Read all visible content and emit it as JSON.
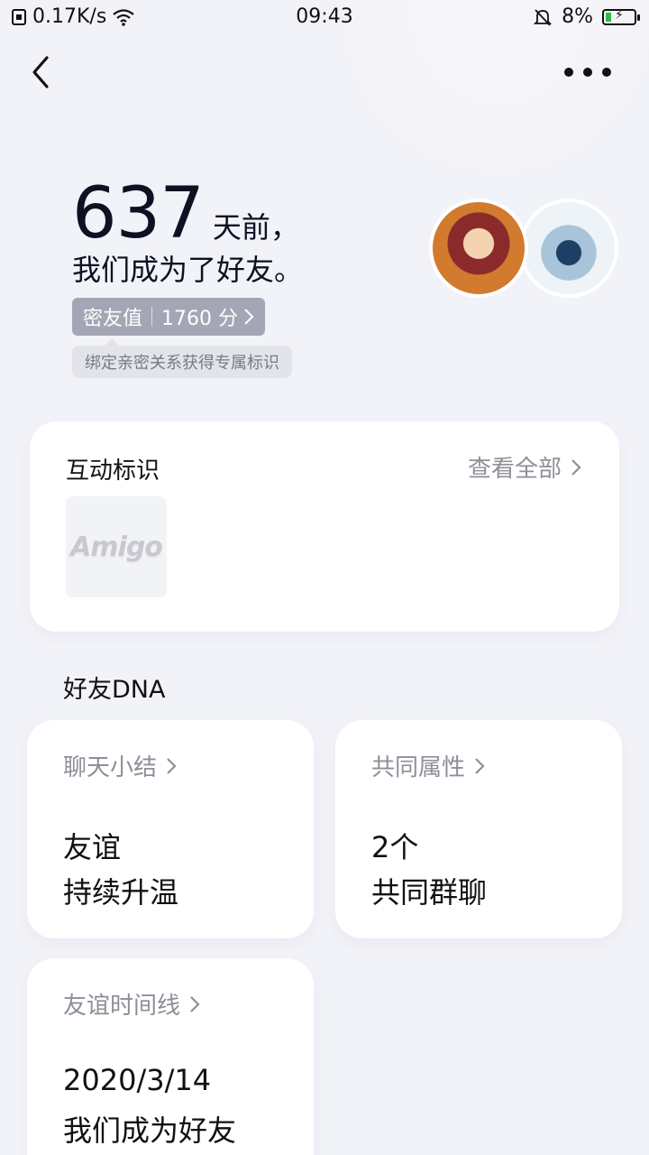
{
  "status_bar": {
    "network_speed": "0.17K/s",
    "time": "09:43",
    "battery_percent": "8%"
  },
  "hero": {
    "days_number": "637",
    "days_suffix": "天前，",
    "became_friends": "我们成为了好友。",
    "score_label": "密友值",
    "score_value": "1760 分",
    "tip": "绑定亲密关系获得专属标识"
  },
  "interaction_card": {
    "title": "互动标识",
    "view_all": "查看全部",
    "badge_text": "Amigo"
  },
  "dna": {
    "title": "好友DNA",
    "cards": [
      {
        "head": "聊天小结",
        "line1": "友谊",
        "line2": "持续升温"
      },
      {
        "head": "共同属性",
        "line1": "2个",
        "line2": "共同群聊"
      },
      {
        "head": "友谊时间线",
        "line1": "2020/3/14",
        "line2": "我们成为好友"
      }
    ]
  },
  "colors": {
    "background": "#f2f3f8",
    "score_pill": "#a3a6b4",
    "secondary_text": "#8d8f99"
  }
}
